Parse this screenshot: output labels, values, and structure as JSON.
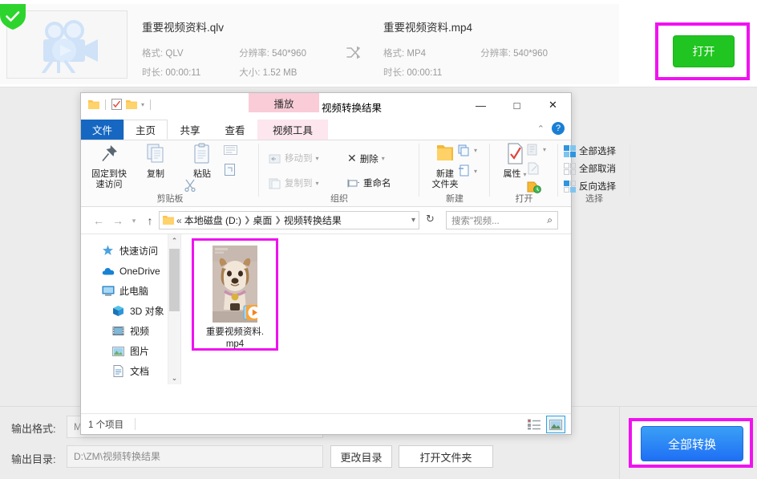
{
  "app": {
    "file_card": {
      "badge": "check-badge",
      "thumbnail_icon": "video-camera-icon",
      "source": {
        "name": "重要视频资料.qlv",
        "format_label": "格式:",
        "format_value": "QLV",
        "resolution_label": "分辨率:",
        "resolution_value": "540*960",
        "duration_label": "时长:",
        "duration_value": "00:00:11",
        "size_label": "大小:",
        "size_value": "1.52 MB"
      },
      "swap_icon": "shuffle-icon",
      "target": {
        "name": "重要视频资料.mp4",
        "format_label": "格式:",
        "format_value": "MP4",
        "resolution_label": "分辨率:",
        "resolution_value": "540*960",
        "duration_label": "时长:",
        "duration_value": "00:00:11"
      },
      "open_button": "打开"
    },
    "bottom": {
      "output_format_label": "输出格式:",
      "output_format_value": "M",
      "output_dir_label": "输出目录:",
      "output_dir_value": "D:\\ZM\\视频转换结果",
      "change_dir_button": "更改目录",
      "open_folder_button": "打开文件夹",
      "convert_all_button": "全部转换"
    },
    "highlight_color": "#f012f0",
    "open_button_color": "#21c521",
    "convert_button_color": "#2f8bf5"
  },
  "explorer": {
    "title": "视频转换结果",
    "quick_access_toolbar": [
      "folder-icon",
      "properties-icon",
      "new-folder-icon",
      "dropdown-icon"
    ],
    "window_buttons": {
      "minimize": "—",
      "maximize": "□",
      "close": "✕"
    },
    "contextual_tab_header": "播放",
    "tabs": [
      {
        "label": "文件",
        "name": "tab-file"
      },
      {
        "label": "主页",
        "name": "tab-home"
      },
      {
        "label": "共享",
        "name": "tab-share"
      },
      {
        "label": "查看",
        "name": "tab-view"
      },
      {
        "label": "视频工具",
        "name": "tab-video-tools"
      }
    ],
    "ribbon_collapse_icon": "chevron-up-icon",
    "help_icon": "?",
    "ribbon": {
      "clipboard": {
        "group_label": "剪贴板",
        "pin": "固定到快\n速访问",
        "pin_line1": "固定到快",
        "pin_line2": "速访问",
        "copy": "复制",
        "paste": "粘贴",
        "cut_icon": "scissors-icon",
        "copy_path_icon": "copy-path-icon",
        "paste_shortcut_icon": "paste-shortcut-icon"
      },
      "organize": {
        "group_label": "组织",
        "move_to": "移动到",
        "copy_to": "复制到",
        "delete": "删除",
        "rename": "重命名"
      },
      "new": {
        "group_label": "新建",
        "new_folder_line1": "新建",
        "new_folder_line2": "文件夹",
        "new_item_icon": "new-item-icon",
        "easy_access_icon": "easy-access-icon"
      },
      "open": {
        "group_label": "打开",
        "properties": "属性",
        "open_with_icon": "open-with-icon",
        "edit_icon": "edit-icon",
        "history_icon": "history-icon"
      },
      "select": {
        "group_label": "选择",
        "select_all": "全部选择",
        "select_none": "全部取消",
        "invert": "反向选择"
      }
    },
    "address_bar": {
      "back_icon": "arrow-left-icon",
      "forward_icon": "arrow-right-icon",
      "recent_icon": "chevron-down-icon",
      "up_icon": "arrow-up-icon",
      "folder_icon": "folder-icon",
      "overflow": "«",
      "crumbs": [
        "本地磁盘 (D:)",
        "桌面",
        "视频转换结果"
      ],
      "dropdown_icon": "chevron-down-icon",
      "refresh_icon": "refresh-icon",
      "search_placeholder": "搜索\"视频...",
      "search_icon": "search-icon"
    },
    "nav_pane": [
      {
        "label": "快速访问",
        "icon": "pin-star-icon"
      },
      {
        "label": "OneDrive",
        "icon": "cloud-icon"
      },
      {
        "label": "此电脑",
        "icon": "computer-icon"
      },
      {
        "label": "3D 对象",
        "icon": "cube-icon"
      },
      {
        "label": "视频",
        "icon": "video-icon"
      },
      {
        "label": "图片",
        "icon": "picture-icon"
      },
      {
        "label": "文档",
        "icon": "document-icon"
      }
    ],
    "file": {
      "label_line1": "重要视频资料.",
      "label_line2": "mp4",
      "overlay_icon": "play-overlay-icon"
    },
    "status": {
      "count": "1 个项目",
      "details_view_icon": "details-view-icon",
      "large_icons_view_icon": "large-icons-view-icon"
    }
  }
}
